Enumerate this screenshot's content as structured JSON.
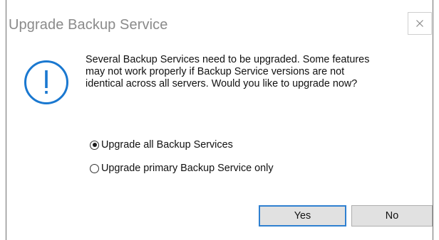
{
  "dialog": {
    "title": "Upgrade Backup Service",
    "close_glyph": "×",
    "icon": "info-exclamation-icon",
    "accent_color": "#1a78d0",
    "message_lines": [
      "Several Backup Services need to be upgraded.  Some features",
      "may not work properly if Backup Service versions are not",
      "identical across all servers.  Would you like to upgrade now?"
    ],
    "options": [
      {
        "label": "Upgrade all Backup Services",
        "checked": true
      },
      {
        "label": "Upgrade primary Backup Service only",
        "checked": false
      }
    ],
    "buttons": {
      "yes_label": "Yes",
      "no_label": "No"
    }
  }
}
